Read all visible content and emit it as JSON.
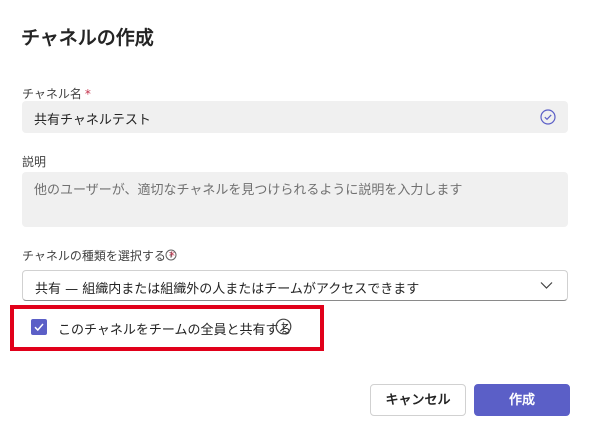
{
  "dialog": {
    "title": "チャネルの作成",
    "required_mark": "*"
  },
  "channel_name": {
    "label": "チャネル名",
    "value": "共有チャネルテスト"
  },
  "description": {
    "label": "説明",
    "placeholder": "他のユーザーが、適切なチャネルを見つけられるように説明を入力します"
  },
  "channel_type": {
    "label": "チャネルの種類を選択する",
    "selected": "共有 — 組織内または組織外の人またはチームがアクセスできます"
  },
  "share_option": {
    "label": "このチャネルをチームの全員と共有する",
    "checked": true
  },
  "buttons": {
    "cancel": "キャンセル",
    "create": "作成"
  },
  "colors": {
    "accent": "#5b5fc7",
    "highlight": "#e1001a",
    "required": "#c4314b"
  }
}
